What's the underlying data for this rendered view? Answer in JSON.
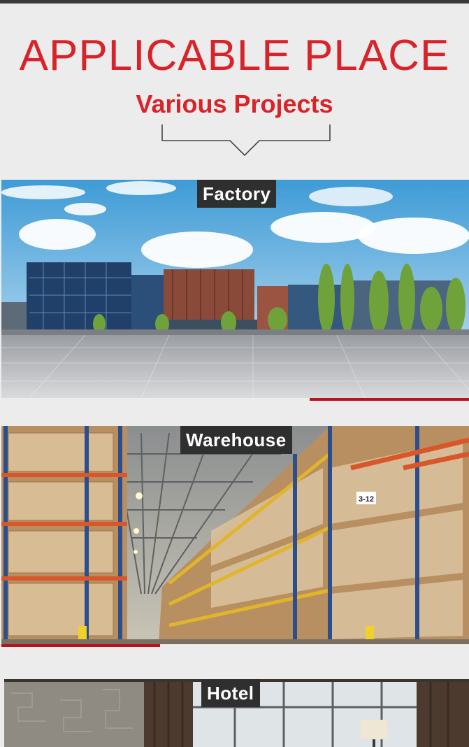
{
  "header": {
    "title": "APPLICABLE PLACE",
    "subtitle": "Various Projects"
  },
  "sections": [
    {
      "label": "Factory",
      "photo": "factory-photo"
    },
    {
      "label": "Warehouse",
      "photo": "warehouse-photo"
    },
    {
      "label": "Hotel",
      "photo": "hotel-photo"
    }
  ],
  "warehouse_sign": "3-12",
  "colors": {
    "accent": "#d8232a",
    "accent_bar": "#b5141b",
    "label_bg": "#2f2f2f",
    "background": "#ececec"
  }
}
